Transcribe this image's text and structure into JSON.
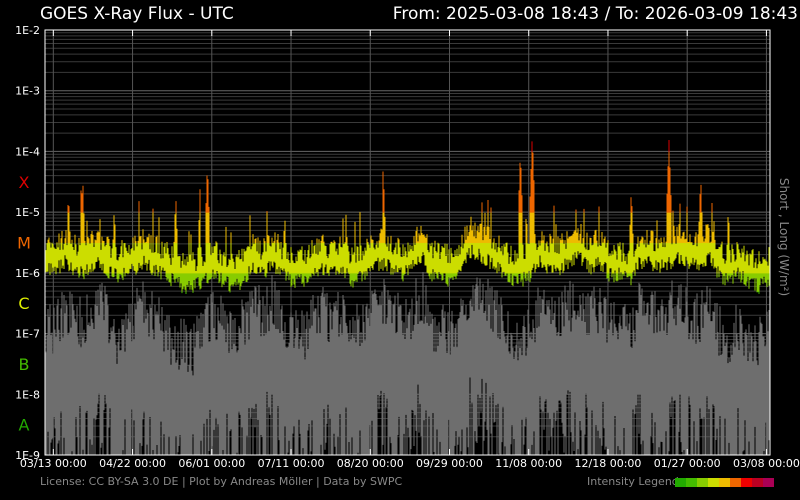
{
  "header": {
    "title": "GOES X-Ray Flux - UTC",
    "range": "From: 2025-03-08 18:43  /  To: 2026-03-09 18:43"
  },
  "footer": {
    "license": "License: CC BY-SA 3.0 DE | Plot by Andreas Möller | Data by SWPC",
    "legend_label": "Intensity Legend"
  },
  "legend_colors": [
    "#22aa00",
    "#44bb00",
    "#88cc00",
    "#ccdd00",
    "#eebb00",
    "#ee6600",
    "#ee0000",
    "#bb0022",
    "#aa0055"
  ],
  "chart_data": {
    "type": "line",
    "title": "GOES X-Ray Flux - UTC",
    "ylabel": "Short , Long (W/m²)",
    "yscale": "log",
    "ylim": [
      1e-09,
      0.01
    ],
    "ytick_labels": [
      "1E-2",
      "1E-3",
      "1E-4",
      "1E-5",
      "1E-6",
      "1E-7",
      "1E-8",
      "1E-9"
    ],
    "class_labels": [
      {
        "label": "X",
        "color": "#dd0000"
      },
      {
        "label": "M",
        "color": "#ee6600"
      },
      {
        "label": "C",
        "color": "#ddee00"
      },
      {
        "label": "B",
        "color": "#44bb00"
      },
      {
        "label": "A",
        "color": "#22aa00"
      }
    ],
    "xlim_days": [
      0,
      366
    ],
    "xtick_labels": [
      "03/13 00:00",
      "04/22 00:00",
      "06/01 00:00",
      "07/11 00:00",
      "08/20 00:00",
      "09/29 00:00",
      "11/08 00:00",
      "12/18 00:00",
      "01/27 00:00",
      "03/08 00:00"
    ],
    "xtick_days": [
      4.2,
      44.2,
      84.2,
      124.2,
      164.2,
      204.2,
      244.2,
      284.2,
      324.2,
      364.2
    ],
    "series": [
      {
        "name": "Long",
        "log10_baseline_every_5_days": [
          -5.8,
          -5.8,
          -5.7,
          -5.8,
          -5.9,
          -5.7,
          -5.8,
          -5.9,
          -5.9,
          -5.8,
          -5.7,
          -5.8,
          -5.9,
          -6.0,
          -6.1,
          -6.1,
          -6.0,
          -5.9,
          -6.0,
          -6.1,
          -6.0,
          -5.8,
          -5.9,
          -5.7,
          -5.9,
          -6.0,
          -6.0,
          -5.9,
          -5.8,
          -5.9,
          -5.8,
          -6.0,
          -5.9,
          -5.8,
          -5.7,
          -5.8,
          -5.9,
          -5.8,
          -5.6,
          -5.9,
          -5.9,
          -6.0,
          -5.8,
          -5.5,
          -5.6,
          -5.7,
          -5.8,
          -6.0,
          -6.0,
          -5.9,
          -5.7,
          -5.8,
          -5.8,
          -5.7,
          -5.6,
          -5.8,
          -5.7,
          -5.9,
          -5.9,
          -6.0,
          -5.7,
          -5.7,
          -5.8,
          -5.7,
          -5.6,
          -5.7,
          -5.8,
          -5.6,
          -5.9,
          -6.0,
          -5.9,
          -6.0,
          -6.1,
          -6.0
        ]
      },
      {
        "name": "Short",
        "log10_baseline_every_5_days": [
          -7.6,
          -7.7,
          -7.3,
          -7.5,
          -7.6,
          -7.4,
          -7.3,
          -7.8,
          -7.8,
          -7.5,
          -7.3,
          -7.5,
          -7.7,
          -7.9,
          -7.9,
          -8.0,
          -7.7,
          -7.4,
          -7.5,
          -7.8,
          -7.6,
          -7.3,
          -7.4,
          -7.2,
          -7.6,
          -7.8,
          -7.8,
          -7.5,
          -7.4,
          -7.6,
          -7.4,
          -7.8,
          -7.6,
          -7.4,
          -7.2,
          -7.3,
          -7.6,
          -7.4,
          -7.1,
          -7.6,
          -7.7,
          -7.8,
          -7.4,
          -7.0,
          -7.1,
          -7.3,
          -7.5,
          -7.9,
          -7.8,
          -7.6,
          -7.3,
          -7.4,
          -7.4,
          -7.3,
          -7.2,
          -7.5,
          -7.3,
          -7.6,
          -7.6,
          -7.8,
          -7.3,
          -7.3,
          -7.5,
          -7.3,
          -7.2,
          -7.4,
          -7.5,
          -7.2,
          -7.7,
          -7.8,
          -7.6,
          -7.8,
          -7.9,
          -7.8
        ]
      }
    ],
    "flares": [
      {
        "day": 19,
        "log10_peak": -4.4
      },
      {
        "day": 35,
        "log10_peak": -4.9
      },
      {
        "day": 66,
        "log10_peak": -4.7
      },
      {
        "day": 78,
        "log10_peak": -4.9
      },
      {
        "day": 82,
        "log10_peak": -4.2
      },
      {
        "day": 121,
        "log10_peak": -5.0
      },
      {
        "day": 152,
        "log10_peak": -5.0
      },
      {
        "day": 171,
        "log10_peak": -4.5
      },
      {
        "day": 222,
        "log10_peak": -4.9
      },
      {
        "day": 240,
        "log10_peak": -4.0
      },
      {
        "day": 246,
        "log10_peak": -3.7
      },
      {
        "day": 268,
        "log10_peak": -4.9
      },
      {
        "day": 296,
        "log10_peak": -4.6
      },
      {
        "day": 315,
        "log10_peak": -3.8
      },
      {
        "day": 331,
        "log10_peak": -4.4
      },
      {
        "day": 345,
        "log10_peak": -4.9
      }
    ]
  }
}
